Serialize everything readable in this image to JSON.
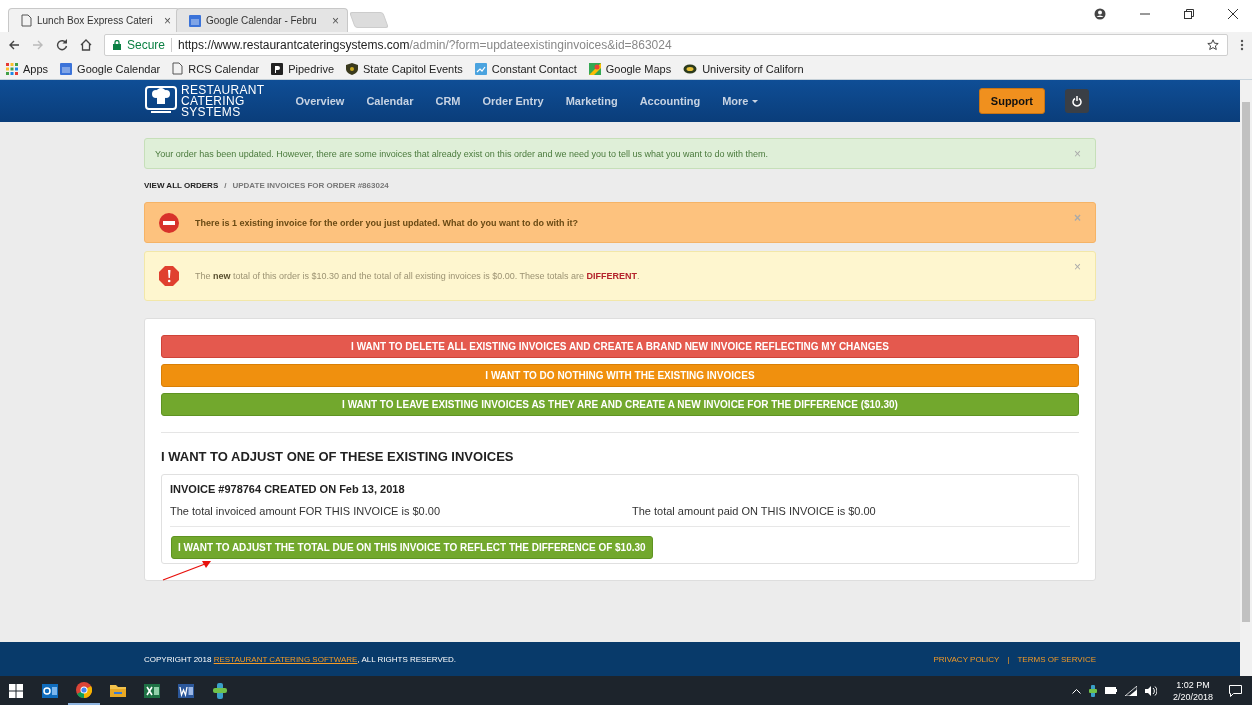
{
  "browser": {
    "tabs": [
      {
        "title": "Lunch Box Express Cateri",
        "close": "×",
        "selected": true
      },
      {
        "title": "Google Calendar - Febru",
        "close": "×",
        "selected": false
      }
    ],
    "address": {
      "secure_label": "Secure",
      "url_host": "https://www.restaurantcateringsystems.com",
      "url_path": "/admin/?form=updateexistinginvoices&id=863024"
    },
    "bookmarks": [
      "Apps",
      "Google Calendar",
      "RCS Calendar",
      "Pipedrive",
      "State Capitol Events",
      "Constant Contact",
      "Google Maps",
      "University of Californ"
    ]
  },
  "navbar": {
    "brand": [
      "RESTAURANT",
      "CATERING",
      "SYSTEMS"
    ],
    "items": [
      "Overview",
      "Calendar",
      "CRM",
      "Order Entry",
      "Marketing",
      "Accounting",
      "More"
    ],
    "support": "Support"
  },
  "notice": {
    "text": "Your order has been updated. However, there are some invoices that already exist on this order and we need you to tell us what you want to do with them.",
    "close": "×"
  },
  "breadcrumb": {
    "link": "VIEW ALL ORDERS",
    "separator": "/",
    "current": "UPDATE INVOICES FOR ORDER #863024"
  },
  "alerts": [
    {
      "kind": "danger",
      "segments": [
        {
          "text": "There is 1 existing invoice for the order you just updated. What do you want to do with it?",
          "kind": "plain"
        }
      ],
      "close": "×"
    },
    {
      "kind": "warning",
      "segments": [
        {
          "text": "The ",
          "kind": "plain"
        },
        {
          "text": "new",
          "kind": "bold"
        },
        {
          "text": " total of this order is $10.30 and the total of all existing invoices is $0.00. These totals are ",
          "kind": "plain"
        },
        {
          "text": "DIFFERENT",
          "kind": "alert"
        },
        {
          "text": ".",
          "kind": "plain"
        }
      ],
      "close": "×"
    }
  ],
  "actions": [
    {
      "kind": "red",
      "label": "I WANT TO DELETE ALL EXISTING INVOICES AND CREATE A BRAND NEW INVOICE REFLECTING MY CHANGES"
    },
    {
      "kind": "orange",
      "label": "I WANT TO DO NOTHING WITH THE EXISTING INVOICES"
    },
    {
      "kind": "green",
      "label": "I WANT TO LEAVE EXISTING INVOICES AS THEY ARE AND CREATE A NEW INVOICE FOR THE DIFFERENCE ($10.30)"
    }
  ],
  "adjust": {
    "heading": "I WANT TO ADJUST ONE OF THESE EXISTING INVOICES",
    "invoices": [
      {
        "title": "INVOICE #978764 CREATED ON Feb 13, 2018",
        "invoiced": "The total invoiced amount FOR THIS INVOICE is $0.00",
        "paid": "The total amount paid ON THIS INVOICE is $0.00",
        "button": "I WANT TO ADJUST THE TOTAL DUE ON THIS INVOICE TO REFLECT THE DIFFERENCE OF $10.30"
      }
    ]
  },
  "footer": {
    "copyright_before": "COPYRIGHT 2018 ",
    "copyright_link": "RESTAURANT CATERING SOFTWARE",
    "copyright_after": ", ALL RIGHTS RESERVED.",
    "links": [
      "PRIVACY POLICY",
      "TERMS OF SERVICE"
    ],
    "separator": "|"
  },
  "taskbar": {
    "time": "1:02 PM",
    "date": "2/20/2018"
  }
}
